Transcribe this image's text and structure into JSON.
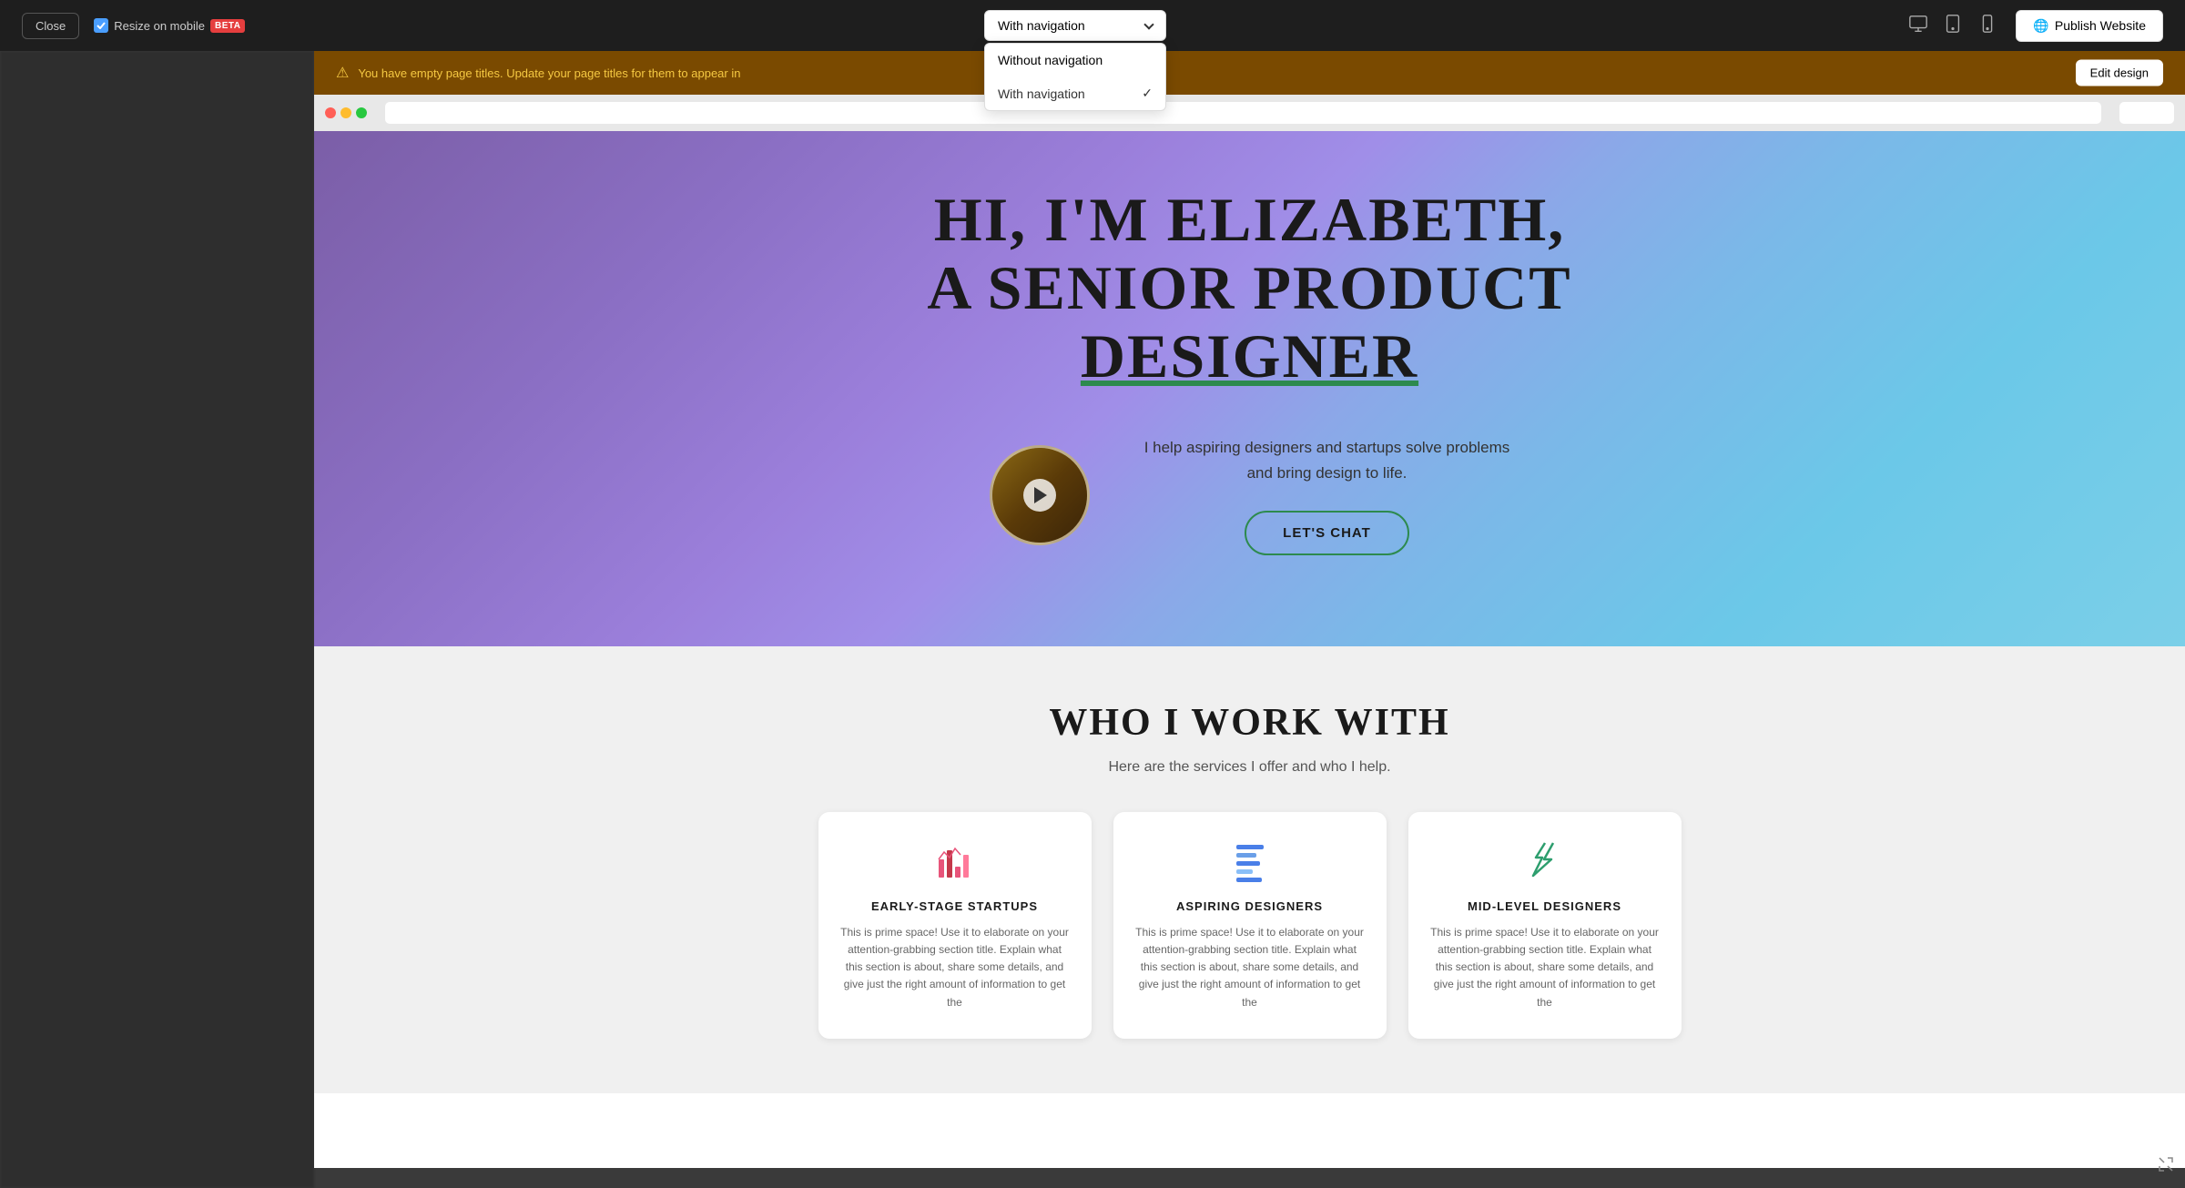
{
  "toolbar": {
    "close_label": "Close",
    "resize_mobile_label": "Resize on mobile",
    "beta_label": "BETA",
    "publish_label": "Publish Website",
    "nav_dropdown": {
      "selected": "With navigation",
      "options": [
        {
          "label": "Without navigation",
          "selected": false
        },
        {
          "label": "With navigation",
          "selected": true
        }
      ]
    }
  },
  "warning": {
    "text": "You have empty page titles. Update your page titles for them to appear in",
    "edit_design_label": "Edit design"
  },
  "hero": {
    "title_line1": "HI, I'M ELIZABETH,",
    "title_line2": "A SENIOR PRODUCT",
    "title_line3": "DESIGNER",
    "subtitle_line1": "I help aspiring designers and startups solve problems",
    "subtitle_line2": "and bring design to life.",
    "cta_label": "LET'S CHAT"
  },
  "work_section": {
    "title": "WHO I WORK WITH",
    "subtitle": "Here are the services I offer and who I help.",
    "cards": [
      {
        "title": "EARLY-STAGE STARTUPS",
        "text": "This is prime space! Use it to elaborate on your attention-grabbing section title. Explain what this section is about, share some details, and give just the right amount of information to get the"
      },
      {
        "title": "ASPIRING DESIGNERS",
        "text": "This is prime space! Use it to elaborate on your attention-grabbing section title. Explain what this section is about, share some details, and give just the right amount of information to get the"
      },
      {
        "title": "MID-LEVEL DESIGNERS",
        "text": "This is prime space! Use it to elaborate on your attention-grabbing section title. Explain what this section is about, share some details, and give just the right amount of information to get the"
      }
    ]
  },
  "icons": {
    "chevron_down": "chevron-down",
    "desktop": "desktop-icon",
    "mobile": "mobile-icon",
    "tablet": "tablet-icon",
    "play": "play-icon",
    "expand": "expand-icon",
    "warning": "warning-icon",
    "check": "✓",
    "globe": "🌐"
  }
}
